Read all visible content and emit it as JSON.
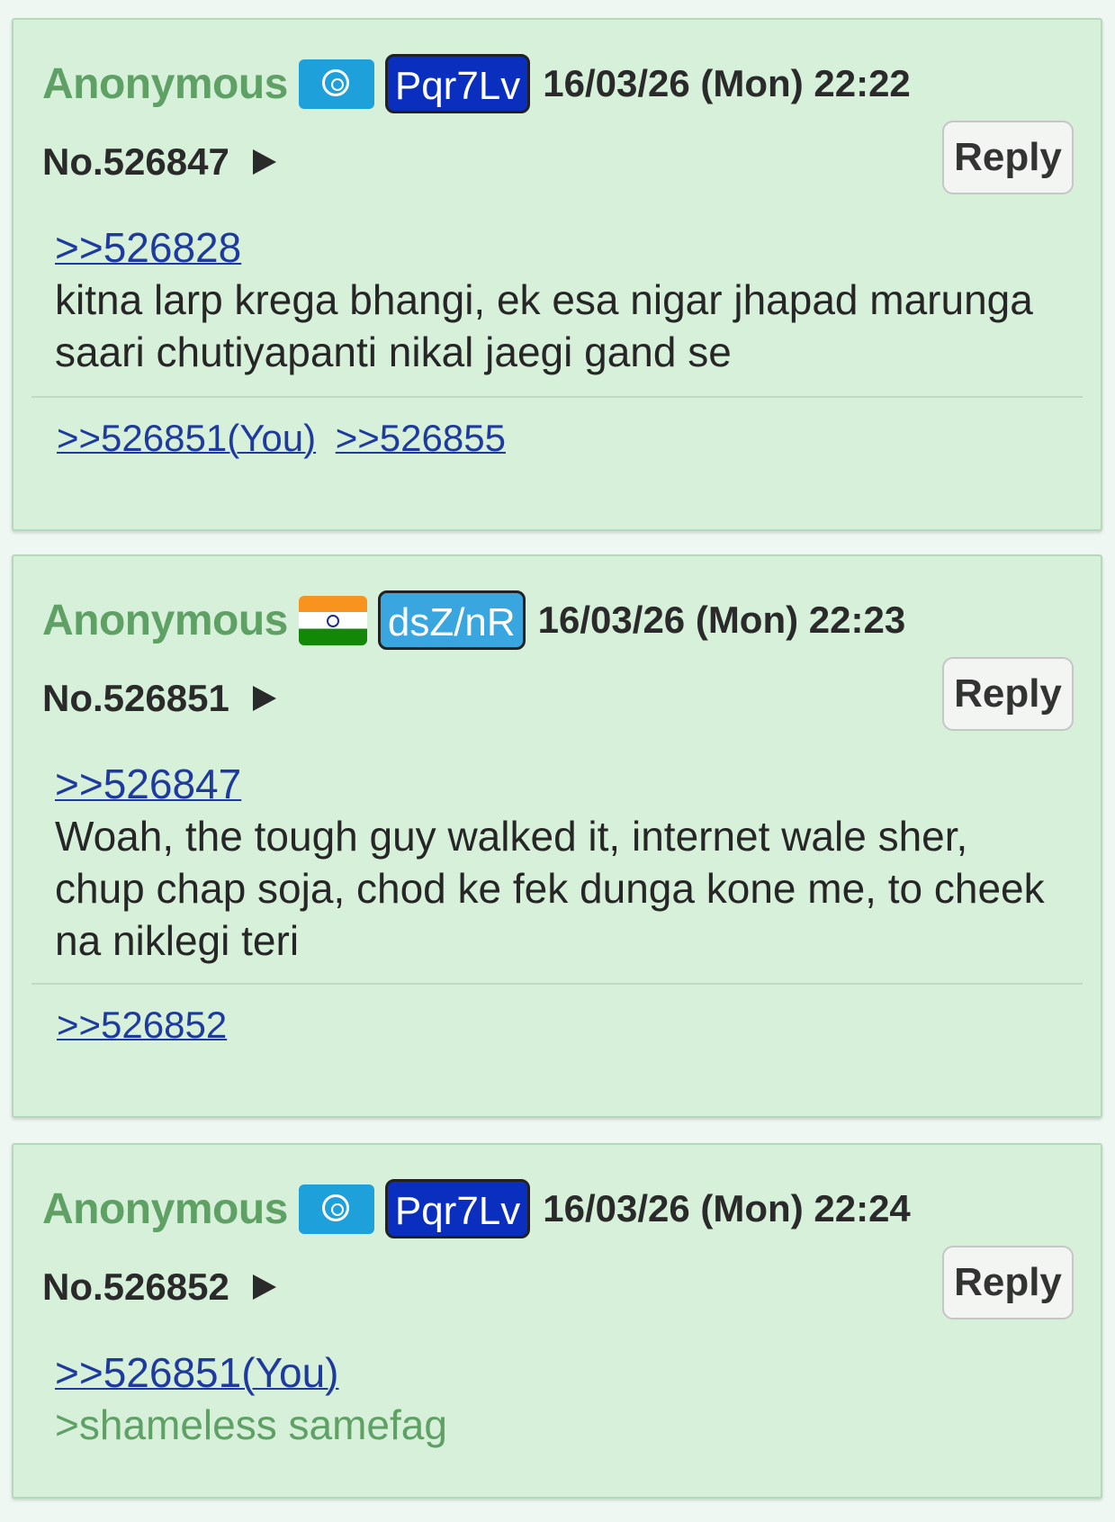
{
  "posts": [
    {
      "name": "Anonymous",
      "flag_icon": "un-flag-icon",
      "poster_id": "Pqr7Lv",
      "poster_id_color": "#0a2fbf",
      "date": "16/03/26 (Mon) 22:22",
      "post_number": "No.526847",
      "reply_label": "Reply",
      "quote": ">>526828",
      "text": "kitna larp krega bhangi, ek esa nigar jhapad marunga saari chutiyapanti nikal jaegi gand se",
      "backlinks": [
        ">>526851(You)",
        ">>526855"
      ]
    },
    {
      "name": "Anonymous",
      "flag_icon": "india-flag-icon",
      "poster_id": "dsZ/nR",
      "poster_id_color": "#3aa6e0",
      "date": "16/03/26 (Mon) 22:23",
      "post_number": "No.526851",
      "reply_label": "Reply",
      "quote": ">>526847",
      "text": "Woah, the tough guy walked it, internet wale sher, chup chap soja, chod ke fek dunga kone me, to cheek na niklegi teri",
      "backlinks": [
        ">>526852"
      ]
    },
    {
      "name": "Anonymous",
      "flag_icon": "un-flag-icon",
      "poster_id": "Pqr7Lv",
      "poster_id_color": "#0a2fbf",
      "date": "16/03/26 (Mon) 22:24",
      "post_number": "No.526852",
      "reply_label": "Reply",
      "quote": ">>526851(You)",
      "greentext": ">shameless samefag"
    }
  ]
}
